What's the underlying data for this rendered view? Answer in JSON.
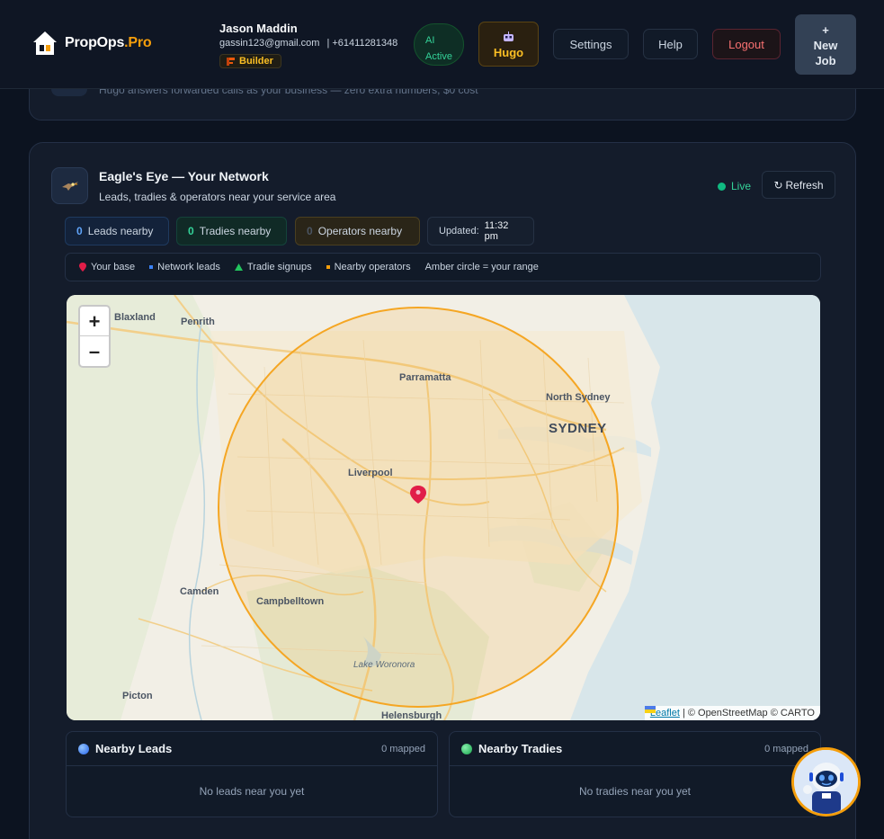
{
  "brand": {
    "name_main": "PropOps",
    "name_accent": ".Pro"
  },
  "user": {
    "name": "Jason Maddin",
    "email": "gassin123@gmail.com",
    "phone": "| +61411281348",
    "role": "Builder"
  },
  "header": {
    "ai_status": [
      "AI",
      "Active"
    ],
    "hugo_label": "Hugo",
    "settings_label": "Settings",
    "help_label": "Help",
    "logout_label": "Logout",
    "new_job_label": [
      "+",
      "New",
      "Job"
    ]
  },
  "prev_card": {
    "subtitle": "Hugo answers forwarded calls as your business — zero extra numbers, $0 cost"
  },
  "eagle": {
    "title": "Eagle's Eye — Your Network",
    "subtitle": "Leads, tradies & operators near your service area",
    "live_label": "Live",
    "refresh_label": "Refresh",
    "stats": {
      "leads_count": "0",
      "leads_label": "Leads nearby",
      "tradies_count": "0",
      "tradies_label": "Tradies nearby",
      "operators_count": "0",
      "operators_label": "Operators nearby",
      "updated_label": "Updated:",
      "updated_time": "11:32 pm"
    },
    "legend": {
      "base": "Your base",
      "leads": "Network leads",
      "tradies": "Tradie signups",
      "operators": "Nearby operators",
      "range": "Amber circle = your range"
    },
    "colors": {
      "leads": "#3b82f6",
      "tradies": "#22c55e",
      "operators": "#f59e0b",
      "range": "#f5a623"
    }
  },
  "map": {
    "zoom_in": "+",
    "zoom_out": "–",
    "attribution_link": "Leaflet",
    "attribution_text": "| © OpenStreetMap © CARTO",
    "places": {
      "blaxland": "Blaxland",
      "penrith": "Penrith",
      "parramatta": "Parramatta",
      "north_sydney": "North Sydney",
      "sydney": "SYDNEY",
      "liverpool": "Liverpool",
      "camden": "Camden",
      "campbelltown": "Campbelltown",
      "lake_woronora": "Lake Woronora",
      "picton": "Picton",
      "helensburgh": "Helensburgh"
    }
  },
  "panels": {
    "leads": {
      "title": "Nearby Leads",
      "count": "0 mapped",
      "empty": "No leads near you yet"
    },
    "tradies": {
      "title": "Nearby Tradies",
      "count": "0 mapped",
      "empty": "No tradies near you yet"
    }
  }
}
